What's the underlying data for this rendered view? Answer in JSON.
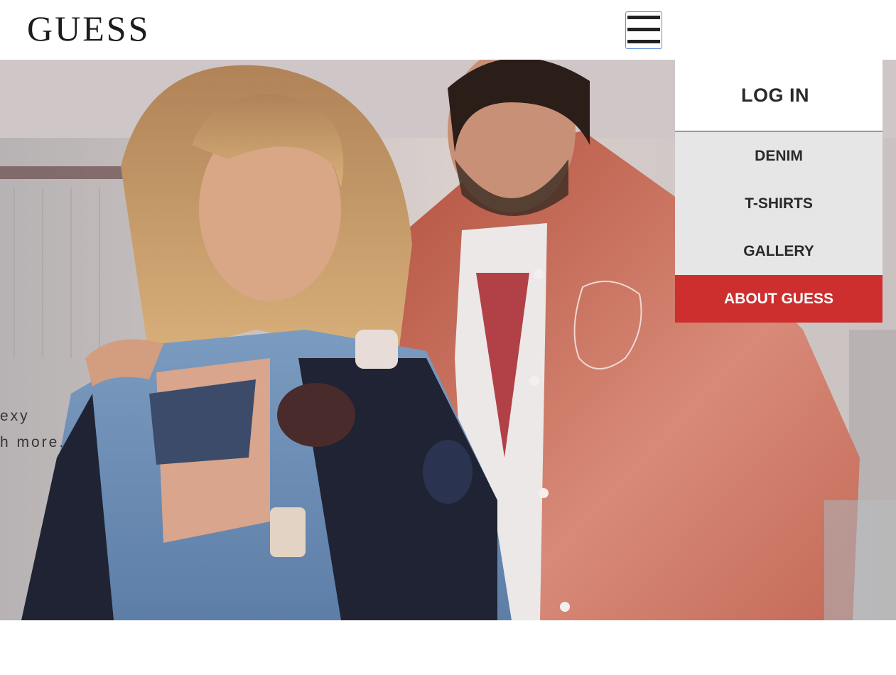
{
  "header": {
    "logo": "GUESS",
    "menu_icon": "hamburger-menu-icon"
  },
  "hero": {
    "image": "campaign-photo-models-in-varsity-and-leather-jackets",
    "text_line_1": "exy",
    "text_line_2": "h more."
  },
  "menu": {
    "login_label": "LOG IN",
    "items": [
      {
        "label": "DENIM"
      },
      {
        "label": "T-SHIRTS"
      },
      {
        "label": "GALLERY"
      }
    ],
    "about_label": "ABOUT GUESS"
  },
  "colors": {
    "accent_red": "#cd2f2f",
    "menu_background": "#e6e6e6",
    "text_dark": "#2a2a2a"
  }
}
